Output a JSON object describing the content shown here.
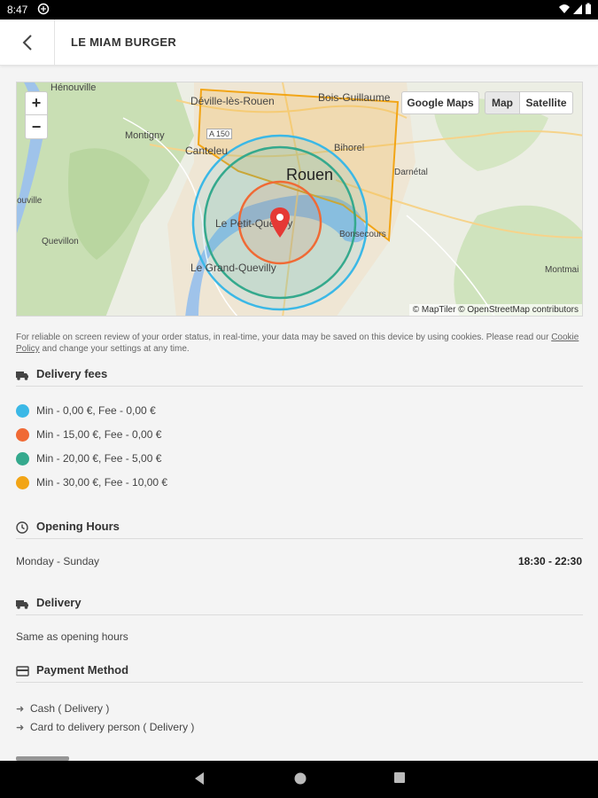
{
  "status_bar": {
    "time": "8:47"
  },
  "app_bar": {
    "title": "LE MIAM BURGER"
  },
  "map": {
    "zoom_in": "+",
    "zoom_out": "−",
    "google_maps": "Google Maps",
    "map_type": "Map",
    "satellite_type": "Satellite",
    "attribution": "© MapTiler © OpenStreetMap contributors",
    "labels": {
      "hénouville": "Hénouville",
      "deville": "Déville-lès-Rouen",
      "bois_guillaume": "Bois-Guillaume",
      "montigny": "Montigny",
      "a150": "A 150",
      "canteleu": "Canteleu",
      "bihorel": "Bihorel",
      "rouen": "Rouen",
      "darnetal": "Darnétal",
      "ouville": "ouville",
      "le_petit_quevilly": "Le Petit-Quevilly",
      "bonsecours": "Bonsecours",
      "quevillon": "Quevillon",
      "le_grand_quevilly": "Le Grand-Quevilly",
      "montmain": "Montmai"
    }
  },
  "cookie_notice": {
    "text": "For reliable on screen review of your order status, in real-time, your data may be saved on this device by using cookies. Please read our",
    "link": "Cookie Policy",
    "text_after": "and change your settings at any time."
  },
  "delivery_fees": {
    "title": "Delivery fees",
    "items": [
      {
        "label": "Min - 0,00 €, Fee - 0,00 €",
        "color": "#3bb8e6"
      },
      {
        "label": "Min - 15,00 €, Fee - 0,00 €",
        "color": "#f06a35"
      },
      {
        "label": "Min - 20,00 €, Fee - 5,00 €",
        "color": "#35a98d"
      },
      {
        "label": "Min - 30,00 €, Fee - 10,00 €",
        "color": "#f2a516"
      }
    ]
  },
  "opening_hours": {
    "title": "Opening Hours",
    "days": "Monday - Sunday",
    "hours": "18:30 - 22:30"
  },
  "delivery": {
    "title": "Delivery",
    "text": "Same as opening hours"
  },
  "payment": {
    "title": "Payment Method",
    "items": [
      "Cash ( Delivery )",
      "Card to delivery person ( Delivery )"
    ]
  },
  "icons": {
    "back": "back-arrow-icon",
    "truck": "truck-icon",
    "clock": "clock-icon",
    "card": "payment-icon",
    "marker": "map-marker-icon"
  }
}
